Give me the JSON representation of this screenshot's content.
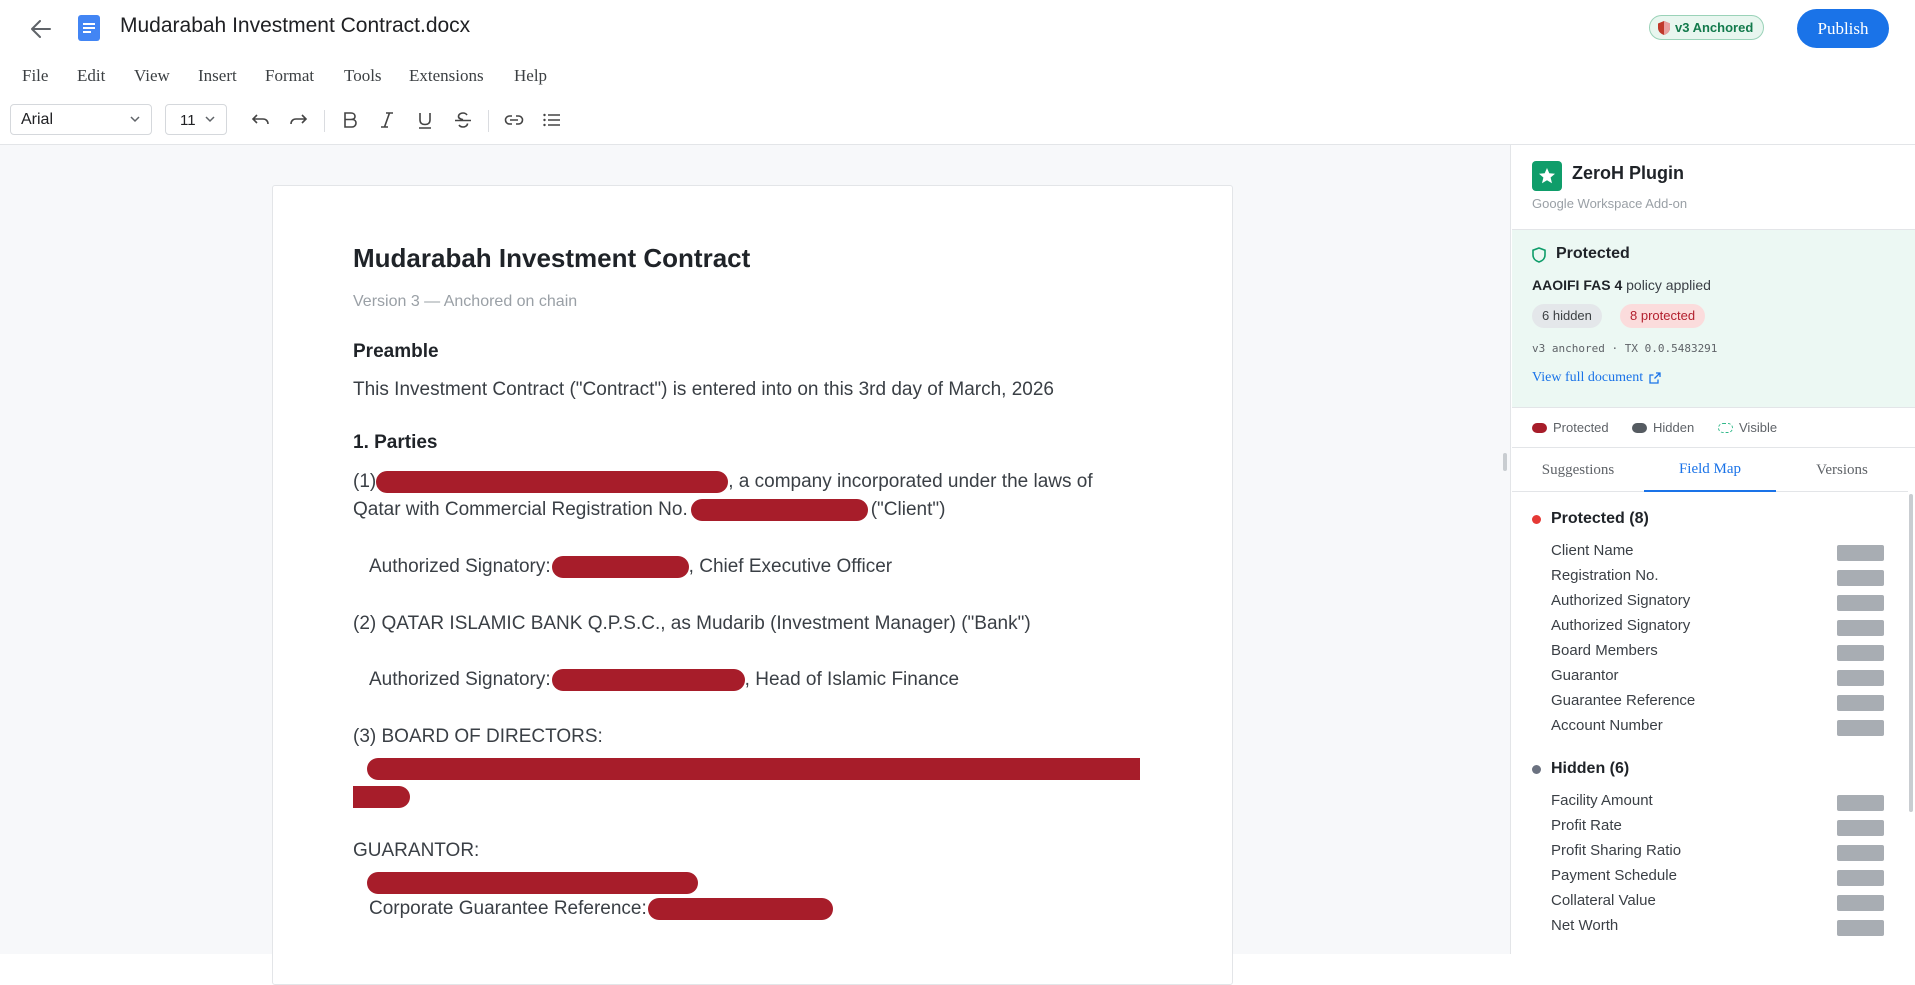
{
  "header": {
    "doc_title": "Mudarabah Investment Contract.docx",
    "anchor_badge": "v3 Anchored",
    "publish_label": "Publish"
  },
  "menu": [
    "File",
    "Edit",
    "View",
    "Insert",
    "Format",
    "Tools",
    "Extensions",
    "Help"
  ],
  "toolbar": {
    "font": "Arial",
    "size": "11",
    "icons": [
      "undo-icon",
      "redo-icon",
      "bold-icon",
      "italic-icon",
      "underline-icon",
      "strikethrough-icon",
      "link-icon",
      "bulleted-list-icon"
    ]
  },
  "document": {
    "title": "Mudarabah Investment Contract",
    "subtitle": "Version 3 — Anchored on chain",
    "preamble_heading": "Preamble",
    "preamble_text": "This Investment Contract (\"Contract\") is entered into on this 3rd day of March, 2026",
    "parties_heading": "1. Parties",
    "party1_prefix": "(1)",
    "party1_suffix": ", a company incorporated under the laws of",
    "party1_line2_prefix": "Qatar with Commercial Registration No.",
    "party1_line2_suffix": "(\"Client\")",
    "party1_signatory_prefix": "Authorized Signatory:",
    "party1_signatory_suffix": ", Chief Executive Officer",
    "party2_text": "(2) QATAR ISLAMIC BANK Q.P.S.C., as Mudarib (Investment Manager) (\"Bank\")",
    "party2_signatory_prefix": "Authorized Signatory:",
    "party2_signatory_suffix": ", Head of Islamic Finance",
    "board_heading": "(3) BOARD OF DIRECTORS:",
    "guarantor_heading": "GUARANTOR:",
    "guarantee_ref_prefix": "Corporate Guarantee Reference:"
  },
  "plugin": {
    "name": "ZeroH Plugin",
    "subtitle": "Google Workspace Add-on",
    "status": "Protected",
    "policy_name": "AAOIFI FAS 4",
    "policy_suffix": " policy applied",
    "hidden_chip": "6 hidden",
    "protected_chip": "8 protected",
    "tx_line": "v3 anchored · TX 0.0.5483291",
    "view_link": "View full document",
    "legend": {
      "protected": "Protected",
      "hidden": "Hidden",
      "visible": "Visible"
    },
    "tabs": [
      "Suggestions",
      "Field Map",
      "Versions"
    ],
    "active_tab": "Field Map",
    "protected_group": {
      "label": "Protected (8)",
      "fields": [
        "Client Name",
        "Registration No.",
        "Authorized Signatory",
        "Authorized Signatory",
        "Board Members",
        "Guarantor",
        "Guarantee Reference",
        "Account Number"
      ]
    },
    "hidden_group": {
      "label": "Hidden (6)",
      "fields": [
        "Facility Amount",
        "Profit Rate",
        "Profit Sharing Ratio",
        "Payment Schedule",
        "Collateral Value",
        "Net Worth"
      ]
    }
  },
  "colors": {
    "accent": "#1a73e8",
    "redaction": "#a71d2a",
    "protected_dot": "#e53935",
    "hidden_dot": "#6b7280",
    "plugin_brand": "#0f9d6a",
    "status_bg": "#ecf8f3"
  }
}
